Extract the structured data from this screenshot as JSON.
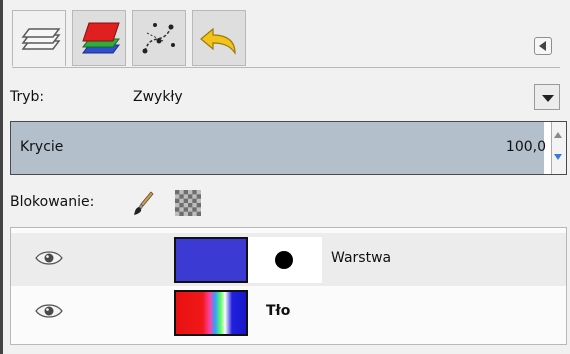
{
  "tabs": [
    {
      "name": "layers",
      "icon": "layers-icon",
      "active": true
    },
    {
      "name": "channels",
      "icon": "channels-icon",
      "active": false
    },
    {
      "name": "paths",
      "icon": "paths-icon",
      "active": false
    },
    {
      "name": "undo-history",
      "icon": "undo-icon",
      "active": false
    }
  ],
  "mode": {
    "label": "Tryb:",
    "value": "Zwykły"
  },
  "opacity": {
    "label": "Krycie",
    "value": "100,0",
    "fraction": 1.0
  },
  "lock": {
    "label": "Blokowanie:"
  },
  "layers": [
    {
      "name": "Warstwa",
      "selected": true,
      "has_mask": true,
      "thumb_color": "#3b3bd4"
    },
    {
      "name": "Tło",
      "selected": false,
      "has_mask": false
    }
  ],
  "colors": {
    "opacity_fill": "#b3c0cc",
    "selected_row": "#ececec"
  }
}
